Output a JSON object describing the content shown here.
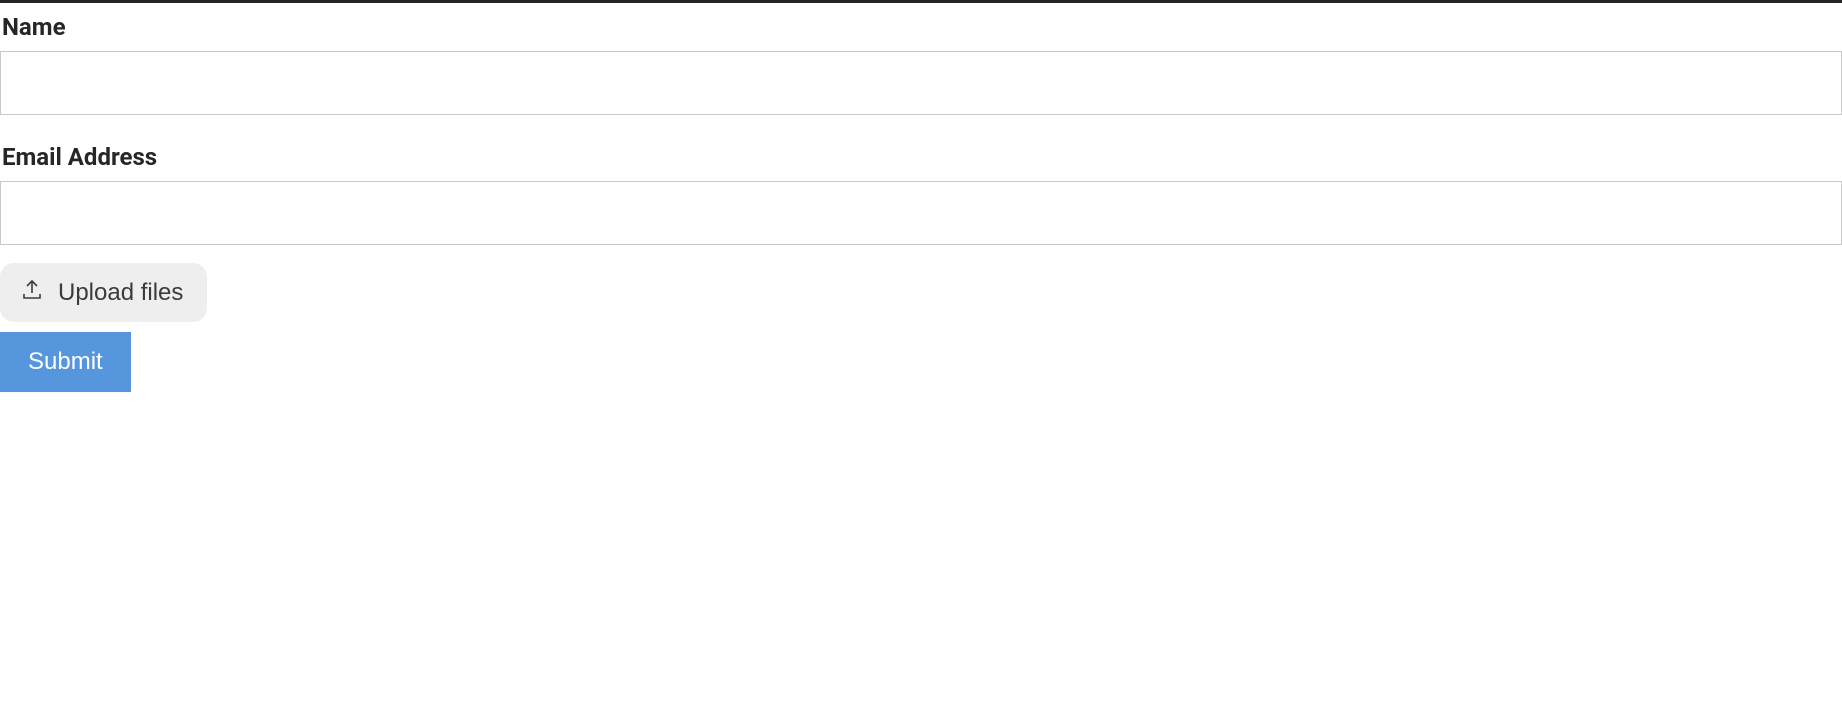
{
  "form": {
    "name": {
      "label": "Name",
      "value": ""
    },
    "email": {
      "label": "Email Address",
      "value": ""
    },
    "upload": {
      "label": "Upload files"
    },
    "submit": {
      "label": "Submit"
    }
  }
}
